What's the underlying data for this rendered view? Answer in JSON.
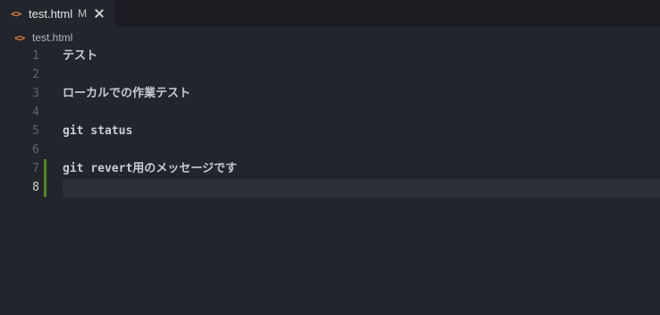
{
  "tab": {
    "icon": "code-icon",
    "label": "test.html",
    "badge": "M"
  },
  "breadcrumb": {
    "icon": "code-icon",
    "label": "test.html"
  },
  "editor": {
    "active_line": 8,
    "lines": [
      {
        "num": "1",
        "text": "テスト"
      },
      {
        "num": "2",
        "text": ""
      },
      {
        "num": "3",
        "text": "ローカルでの作業テスト"
      },
      {
        "num": "4",
        "text": ""
      },
      {
        "num": "5",
        "text": "git status"
      },
      {
        "num": "6",
        "text": ""
      },
      {
        "num": "7",
        "text": "git revert用のメッセージです"
      },
      {
        "num": "8",
        "text": ""
      }
    ]
  },
  "colors": {
    "background": "#23252c",
    "git_added": "#4e8a1e",
    "file_icon": "#e8833a"
  }
}
